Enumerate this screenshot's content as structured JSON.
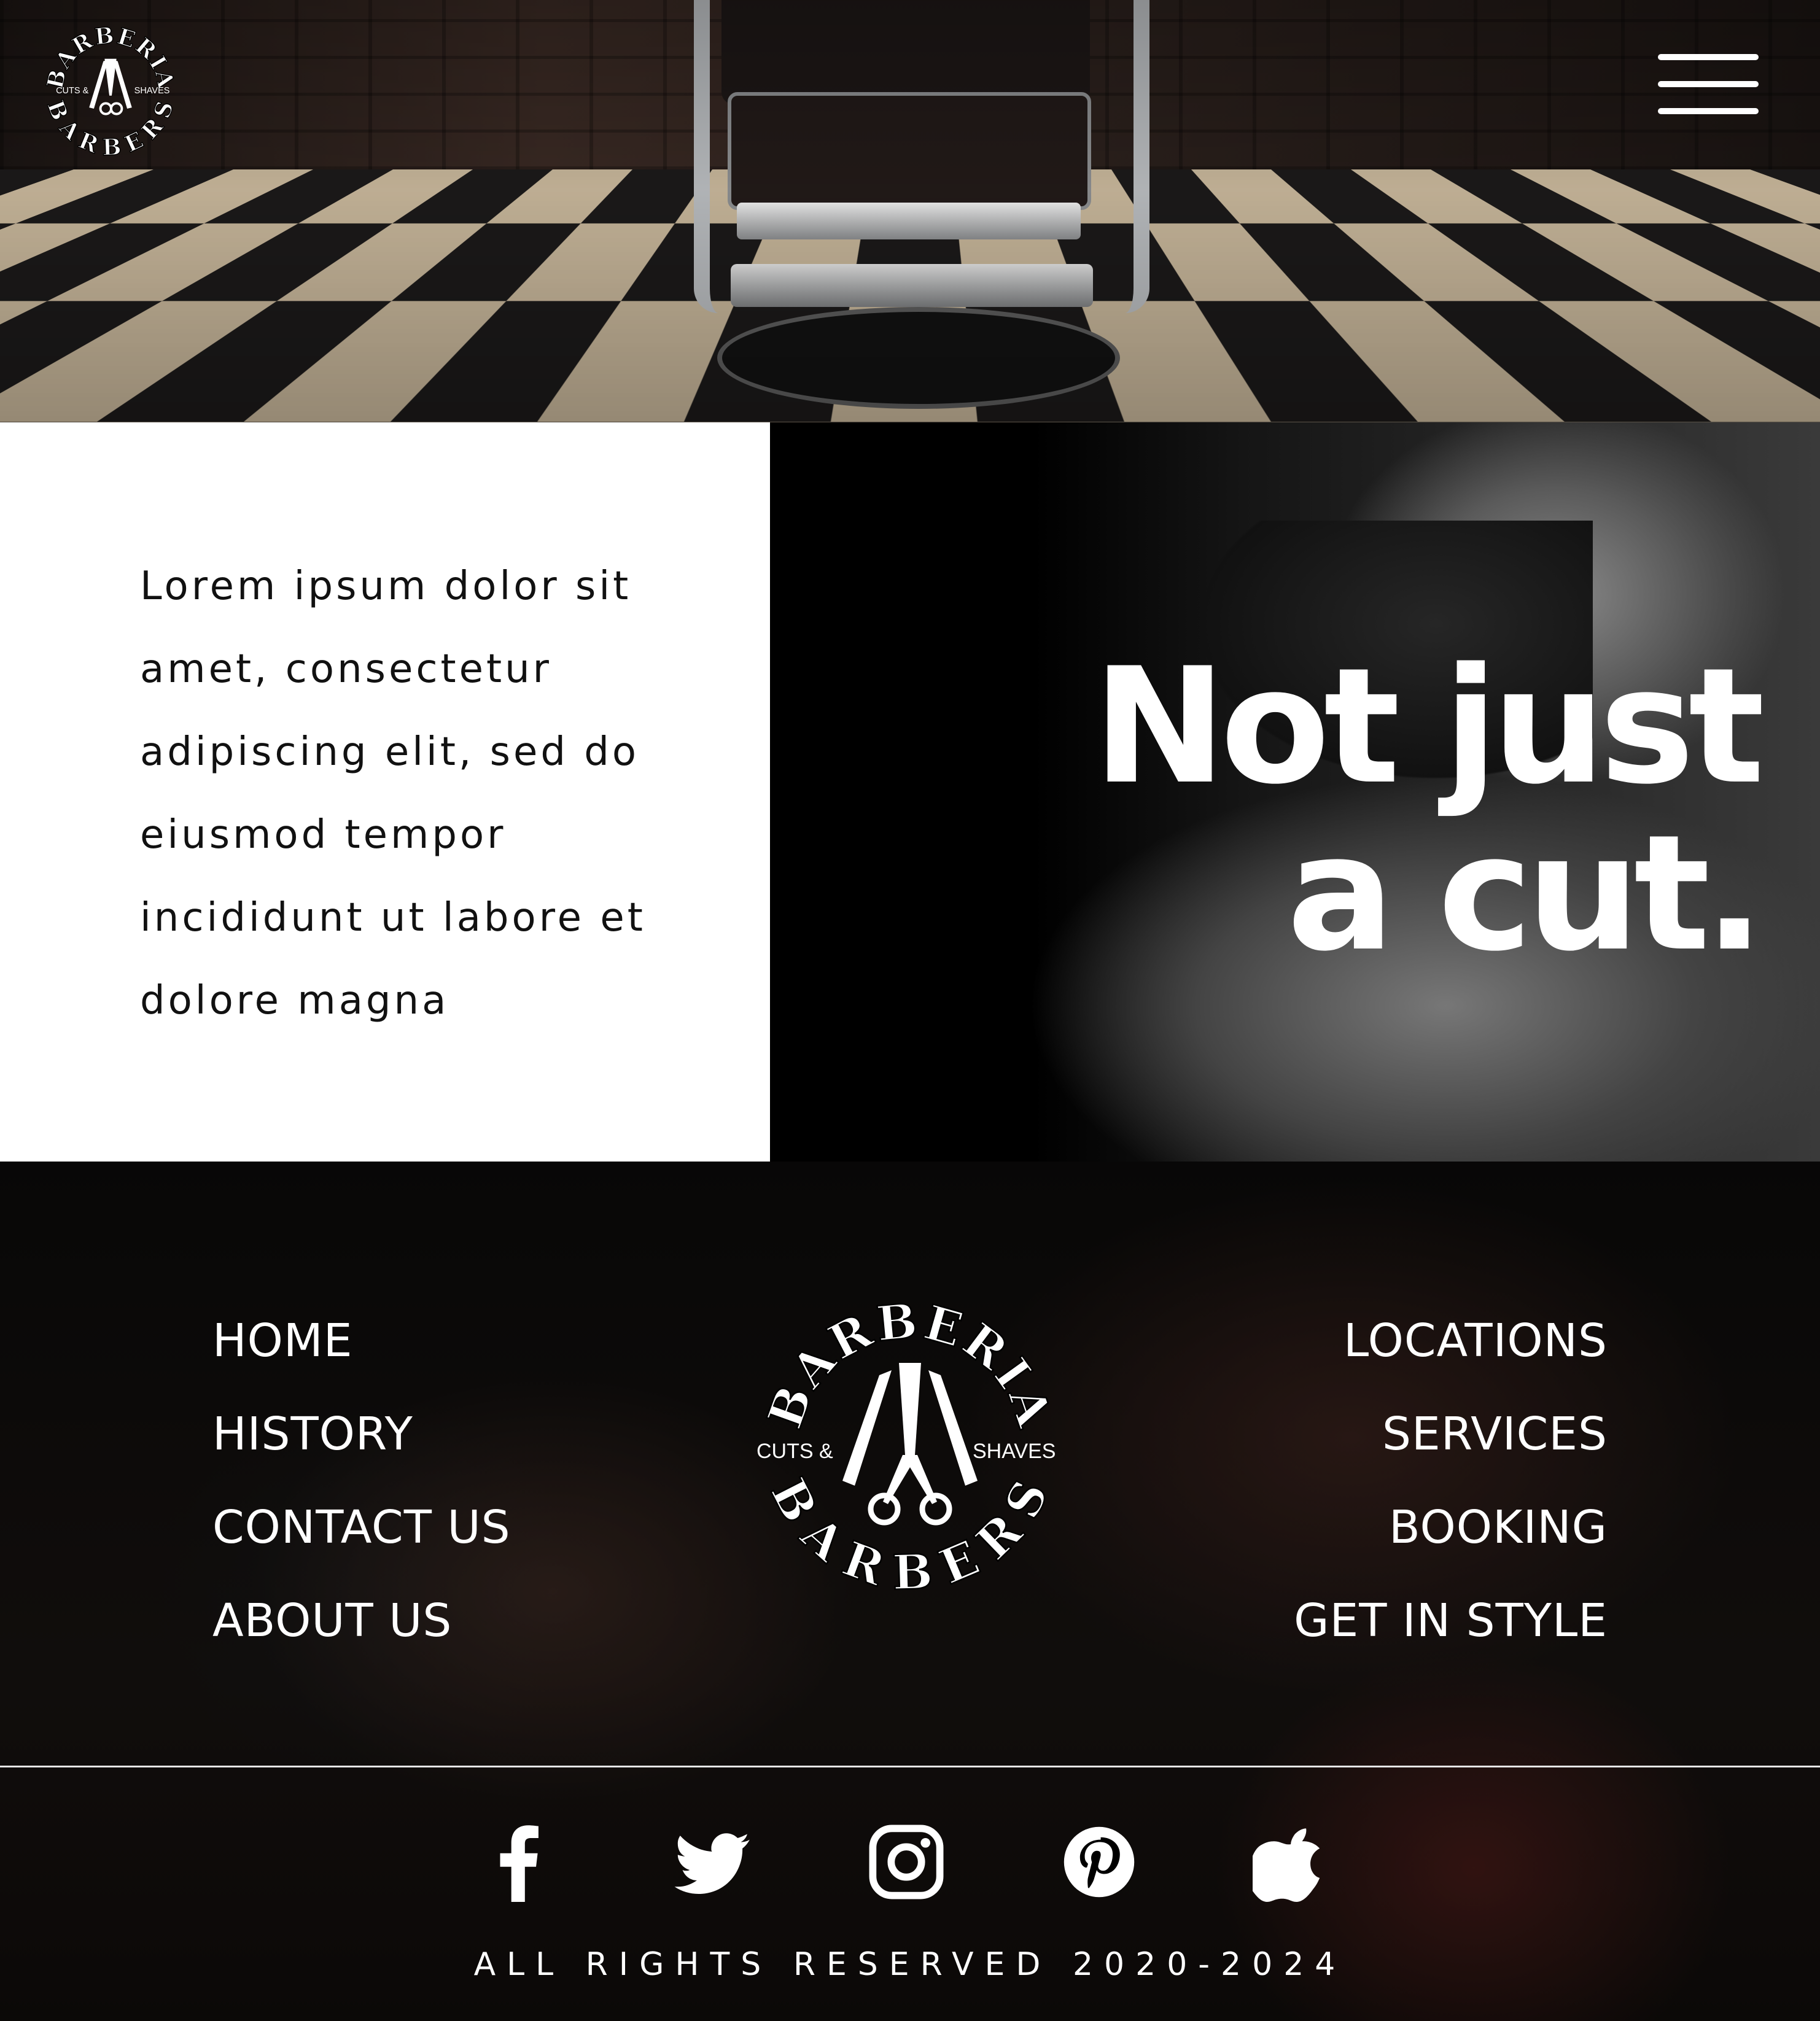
{
  "brand": {
    "arc_top": "BARBERIA",
    "arc_bottom": "BARBERS",
    "left_text": "CUTS &",
    "right_text": "SHAVES"
  },
  "header": {
    "menu_icon": "hamburger-menu-icon"
  },
  "intro": {
    "text": "Lorem ipsum dolor sit amet, consectetur adipiscing elit, sed do eiusmod tempor incididunt ut labore et dolore magna"
  },
  "tagline": {
    "line1": "Not just",
    "line2": "a cut."
  },
  "footer": {
    "nav_left": [
      "HOME",
      "HISTORY",
      "CONTACT US",
      "ABOUT US"
    ],
    "nav_right": [
      "LOCATIONS",
      "SERVICES",
      "BOOKING",
      "GET IN STYLE"
    ],
    "social_icons": [
      "facebook-icon",
      "twitter-icon",
      "instagram-icon",
      "pinterest-icon",
      "apple-icon"
    ],
    "copyright": "ALL RIGHTS RESERVED 2020-2024"
  },
  "colors": {
    "background_dark": "#000000",
    "panel_light": "#ffffff",
    "text_light": "#ffffff",
    "text_dark": "#111111"
  }
}
